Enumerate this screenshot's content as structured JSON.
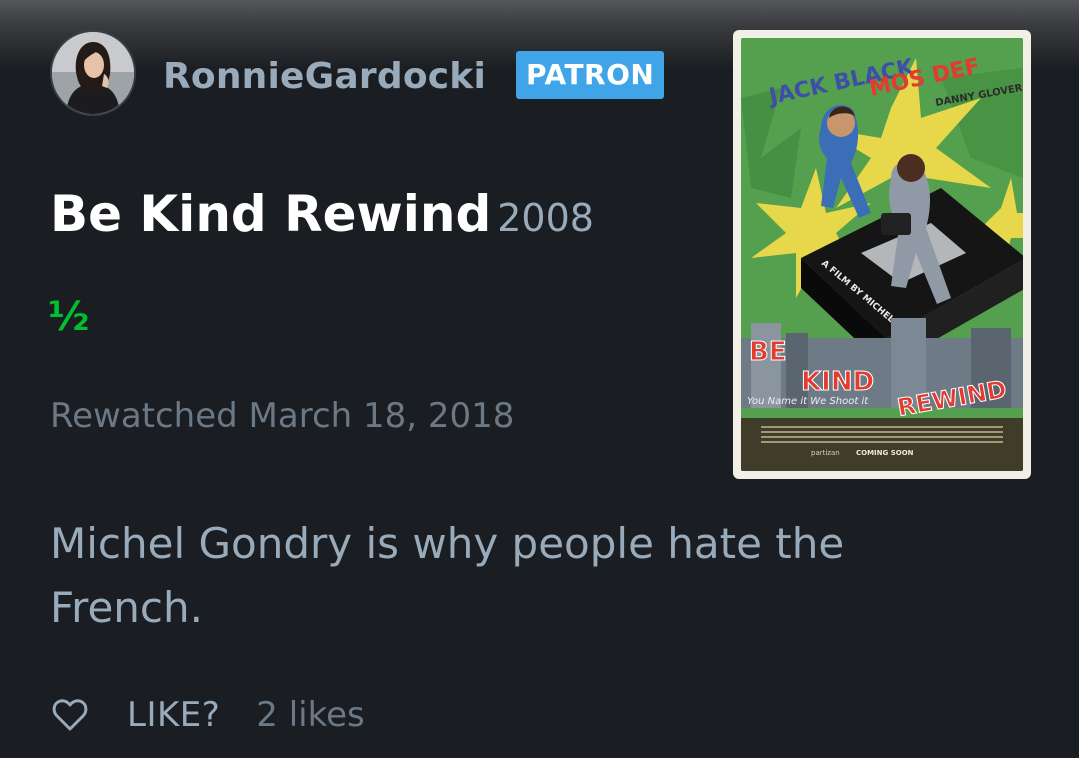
{
  "review": {
    "username": "RonnieGardocki",
    "badge": "PATRON",
    "film_title": "Be Kind Rewind",
    "film_year": "2008",
    "rating": "½",
    "watched_label": "Rewatched March 18, 2018",
    "text": "Michel Gondry is why people hate the French.",
    "like_label": "LIKE?",
    "like_count": "2 likes"
  },
  "poster": {
    "cast_line_1": "JACK BLACK",
    "cast_line_2": "MOS DEF",
    "cast_line_3": "DANNY GLOVER",
    "title_word_1": "BE",
    "title_word_2": "KIND",
    "title_word_3": "REWIND",
    "director_line": "A FILM BY MICHEL GONDRY",
    "tagline": "You Name it We Shoot it",
    "coming_soon": "COMING SOON",
    "distributor": "partizan"
  },
  "colors": {
    "background": "#1a1d21",
    "badge": "#40a5e8",
    "rating_green": "#00c030",
    "muted_text": "#99aabb",
    "date_text": "#6b7886"
  },
  "icons": {
    "like": "heart-outline-icon"
  }
}
